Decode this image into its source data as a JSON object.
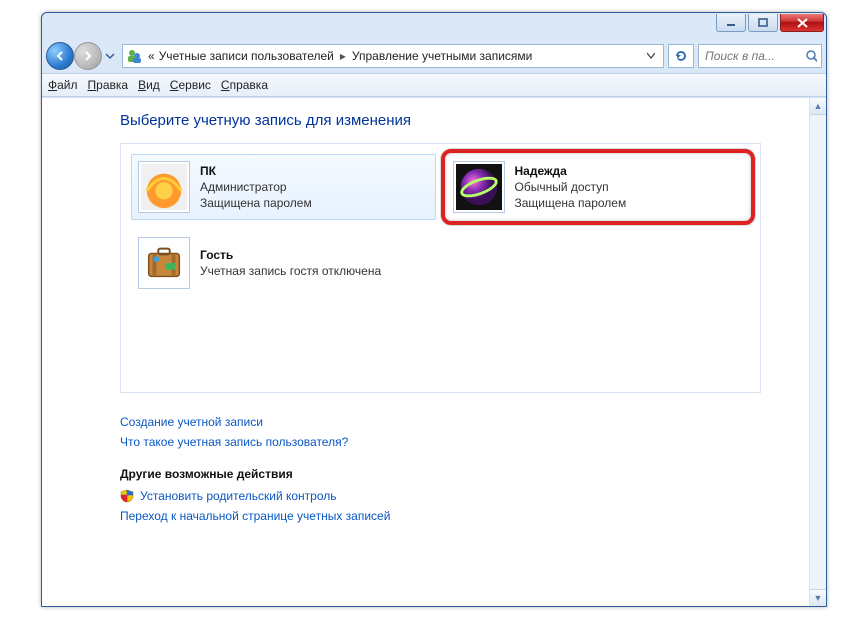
{
  "breadcrumb": {
    "prefix": "«",
    "seg1": "Учетные записи пользователей",
    "seg2": "Управление учетными записями"
  },
  "search": {
    "placeholder": "Поиск в па..."
  },
  "menu": {
    "file": "Файл",
    "edit": "Правка",
    "view": "Вид",
    "tools": "Сервис",
    "help": "Справка"
  },
  "page": {
    "title": "Выберите учетную запись для изменения"
  },
  "accounts": [
    {
      "name": "ПК",
      "role": "Администратор",
      "status": "Защищена паролем"
    },
    {
      "name": "Надежда",
      "role": "Обычный доступ",
      "status": "Защищена паролем"
    },
    {
      "name": "Гость",
      "role": "Учетная запись гостя отключена",
      "status": ""
    }
  ],
  "links": {
    "create": "Создание учетной записи",
    "what": "Что такое учетная запись пользователя?"
  },
  "other": {
    "heading": "Другие возможные действия",
    "parental": "Установить родительский контроль",
    "home": "Переход к начальной странице учетных записей"
  }
}
